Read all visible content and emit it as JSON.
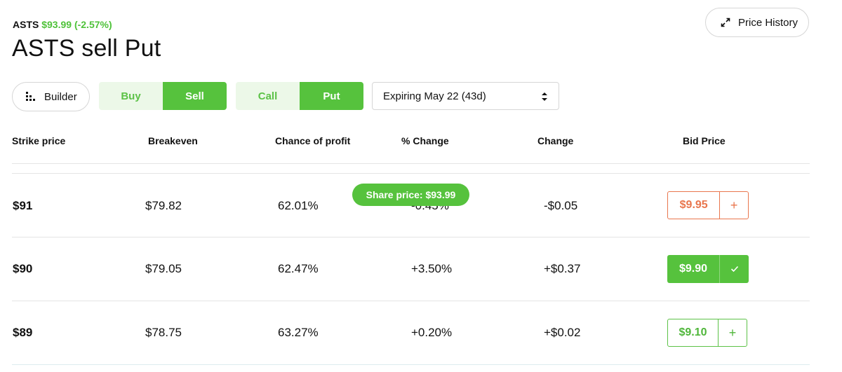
{
  "header": {
    "symbol": "ASTS",
    "quote": "$93.99 (-2.57%)",
    "title": "ASTS sell Put",
    "price_history_label": "Price History"
  },
  "controls": {
    "builder_label": "Builder",
    "side_options": [
      {
        "label": "Buy"
      },
      {
        "label": "Sell"
      }
    ],
    "selected_side": "Sell",
    "type_options": [
      {
        "label": "Call"
      },
      {
        "label": "Put"
      }
    ],
    "selected_type": "Put",
    "expiry_value": "Expiring May 22 (43d)"
  },
  "table": {
    "columns": [
      "Strike price",
      "Breakeven",
      "Chance of profit",
      "% Change",
      "Change",
      "Bid Price"
    ],
    "rows": [
      {
        "strike": "$91",
        "breakeven": "$79.82",
        "chance": "62.01%",
        "pct_change": "-0.45%",
        "change": "-$0.05",
        "bid": "$9.95",
        "bid_state": "highlighted",
        "action_icon": "plus-icon"
      },
      {
        "strike": "$90",
        "breakeven": "$79.05",
        "chance": "62.47%",
        "pct_change": "+3.50%",
        "change": "+$0.37",
        "bid": "$9.90",
        "bid_state": "selected",
        "action_icon": "check-icon"
      },
      {
        "strike": "$89",
        "breakeven": "$78.75",
        "chance": "63.27%",
        "pct_change": "+0.20%",
        "change": "+$0.02",
        "bid": "$9.10",
        "bid_state": "default",
        "action_icon": "plus-icon"
      }
    ],
    "share_price_label": "Share price: $93.99"
  },
  "colors": {
    "accent_green": "#56c23d",
    "accent_green_light": "#ecf8e8",
    "highlight_orange": "#e9764d"
  }
}
